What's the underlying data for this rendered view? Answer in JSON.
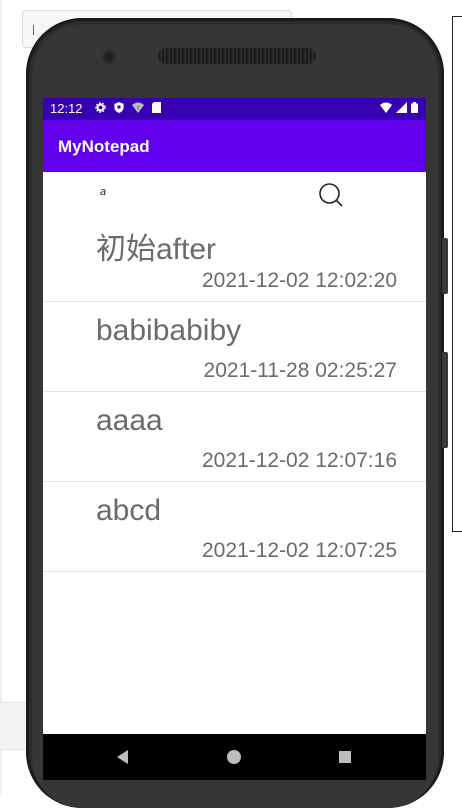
{
  "status_bar": {
    "time": "12:12",
    "left_icons": [
      "settings-gear-icon",
      "shield-icon",
      "wifi-question-icon",
      "sd-card-icon"
    ],
    "right_icons": [
      "wifi-icon",
      "signal-icon",
      "battery-icon"
    ]
  },
  "app_bar": {
    "title": "MyNotepad",
    "color": "#6200ee",
    "status_color": "#3700b3"
  },
  "search": {
    "value": "a"
  },
  "notes": [
    {
      "title": "初始after",
      "date": "2021-12-02 12:02:20"
    },
    {
      "title": "babibabiby",
      "date": "2021-11-28 02:25:27"
    },
    {
      "title": "aaaa",
      "date": "2021-12-02 12:07:16"
    },
    {
      "title": "abcd",
      "date": "2021-12-02 12:07:25"
    }
  ],
  "nav_bar": {
    "buttons": [
      "back-icon",
      "home-icon",
      "recents-icon"
    ]
  }
}
